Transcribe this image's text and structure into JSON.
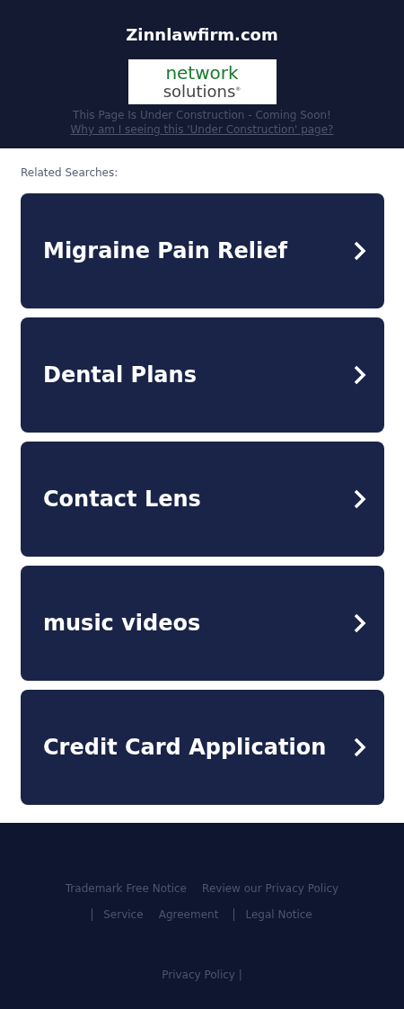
{
  "header": {
    "domain": "Zinnlawfirm.com",
    "logo": {
      "line_1": "network",
      "line_2": "solutions",
      "mark": "®"
    },
    "notice": "This Page Is Under Construction - Coming Soon!",
    "notice_link": "Why am I seeing this 'Under Construction' page?"
  },
  "related": {
    "label": "Related Searches:",
    "items": [
      {
        "label": "Migraine Pain Relief"
      },
      {
        "label": "Dental Plans"
      },
      {
        "label": "Contact Lens"
      },
      {
        "label": "music videos"
      },
      {
        "label": "Credit Card Application"
      }
    ]
  },
  "footer": {
    "links": [
      {
        "label": "Trademark Free Notice",
        "separated": false
      },
      {
        "label": "Review our Privacy Policy",
        "separated": false
      },
      {
        "label": "Service",
        "separated": true
      },
      {
        "label": "Agreement",
        "separated": false
      },
      {
        "label": "Legal Notice",
        "separated": true
      }
    ],
    "bottom_link": "Privacy Policy |"
  }
}
